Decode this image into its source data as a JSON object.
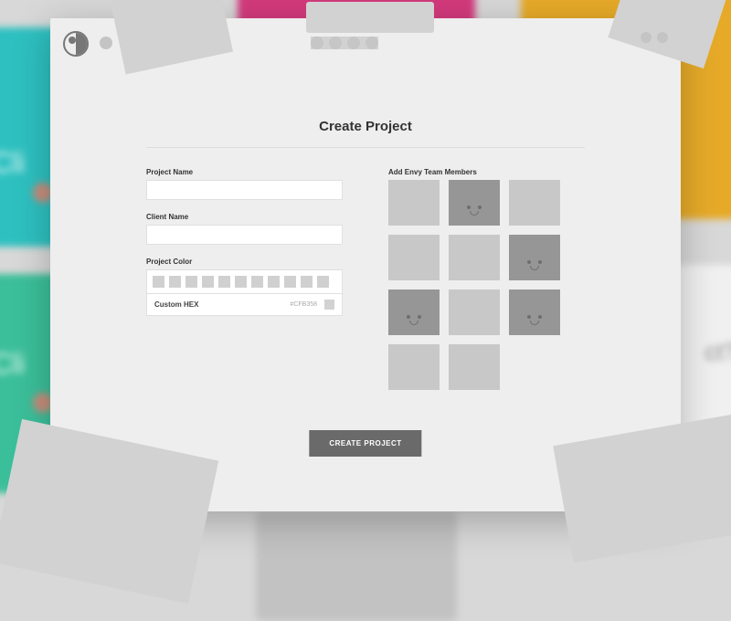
{
  "modal": {
    "title": "Create Project",
    "cta_label": "CREATE PROJECT"
  },
  "form": {
    "project_name_label": "Project Name",
    "project_name_value": "",
    "client_name_label": "Client Name",
    "client_name_value": "",
    "project_color_label": "Project Color",
    "custom_hex_label": "Custom HEX",
    "custom_hex_value": "#CFB358",
    "color_swatches": [
      "#d0d0d0",
      "#d0d0d0",
      "#d0d0d0",
      "#d0d0d0",
      "#d0d0d0",
      "#d0d0d0",
      "#d0d0d0",
      "#d0d0d0",
      "#d0d0d0",
      "#d0d0d0",
      "#d0d0d0"
    ]
  },
  "team": {
    "section_label": "Add Envy Team Members",
    "members": [
      {
        "selected": false
      },
      {
        "selected": true
      },
      {
        "selected": false
      },
      {
        "selected": false
      },
      {
        "selected": false
      },
      {
        "selected": true
      },
      {
        "selected": true
      },
      {
        "selected": false
      },
      {
        "selected": true
      },
      {
        "selected": false
      },
      {
        "selected": false
      }
    ]
  },
  "background_text": {
    "card1": "Cli",
    "card2": "Cli",
    "card3": "ct?"
  }
}
